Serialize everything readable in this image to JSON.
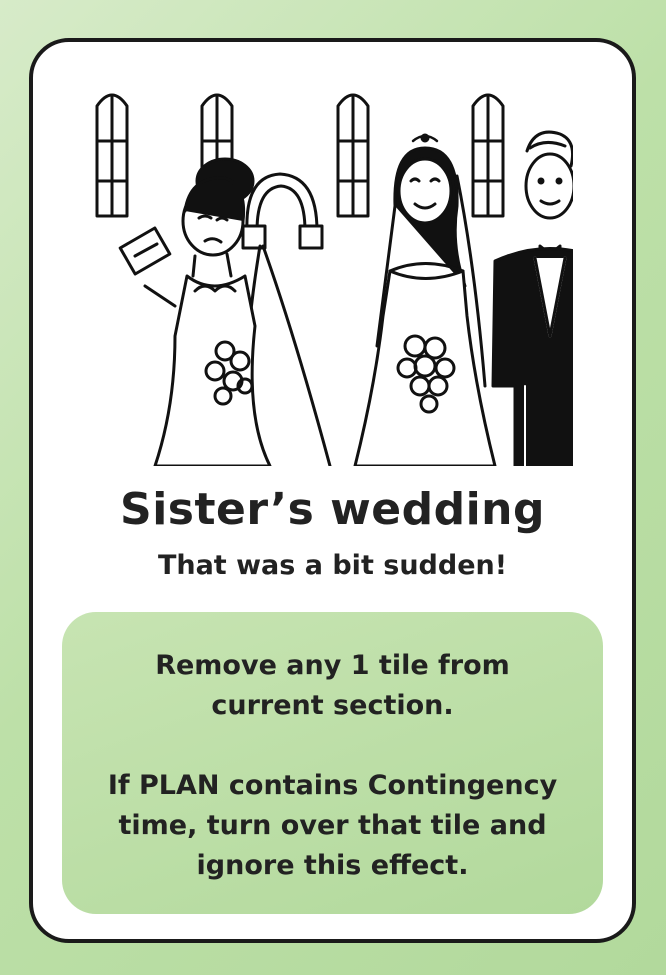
{
  "card": {
    "title": "Sister’s wedding",
    "subtitle": "That was a bit sudden!",
    "effect": {
      "lines": [
        "Remove any 1 tile from",
        "current section.",
        "If PLAN contains Contingency",
        "time, turn over that tile and",
        "ignore this effect."
      ]
    },
    "illustration": "wedding-scene-illustration"
  },
  "colors": {
    "background": "#bde0a8",
    "effect_box": "#b2d99c",
    "text": "#222222",
    "border": "#1a1a1a"
  }
}
